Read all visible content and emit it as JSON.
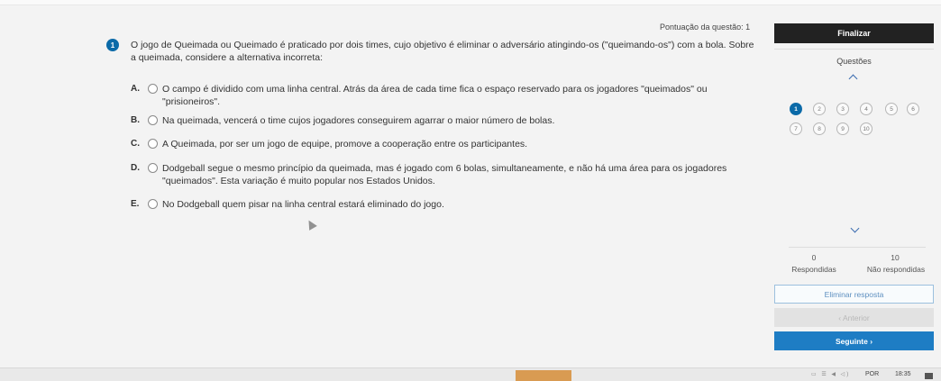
{
  "header": {
    "score_label": "Pontuação da questão: 1"
  },
  "question": {
    "number": "1",
    "text": "O jogo de Queimada ou Queimado é praticado por dois times, cujo objetivo é eliminar o adversário atingindo-os (\"queimando-os\") com a bola. Sobre a queimada, considere a alternativa incorreta:",
    "options": [
      {
        "letter": "A.",
        "text": "O campo é dividido com uma linha central. Atrás da área de cada time fica o espaço reservado para os jogadores \"queimados\" ou \"prisioneiros\"."
      },
      {
        "letter": "B.",
        "text": "Na queimada, vencerá o time cujos jogadores conseguirem agarrar o maior número de bolas."
      },
      {
        "letter": "C.",
        "text": "A Queimada, por ser um jogo de equipe, promove a cooperação entre os participantes."
      },
      {
        "letter": "D.",
        "text": "Dodgeball segue o mesmo princípio da queimada, mas é jogado com 6 bolas, simultaneamente, e não há uma área para os jogadores \"queimados\". Esta variação é muito popular nos Estados Unidos."
      },
      {
        "letter": "E.",
        "text": "No Dodgeball quem pisar na linha central estará eliminado do jogo."
      }
    ]
  },
  "sidebar": {
    "finalize_label": "Finalizar",
    "questions_title": "Questões",
    "question_buttons": [
      "1",
      "2",
      "3",
      "4",
      "5",
      "6",
      "7",
      "8",
      "9",
      "10"
    ],
    "active_question": "1",
    "answered_count": "0",
    "answered_label": "Respondidas",
    "unanswered_count": "10",
    "unanswered_label": "Não respondidas",
    "eliminate_label": "Eliminar resposta",
    "previous_label": "‹ Anterior",
    "next_label": "Seguinte ›"
  },
  "taskbar": {
    "language": "POR",
    "time": "18:35"
  },
  "colors": {
    "accent": "#0b6aa8",
    "next_button": "#1e7dc4",
    "finalize_button": "#222222"
  }
}
